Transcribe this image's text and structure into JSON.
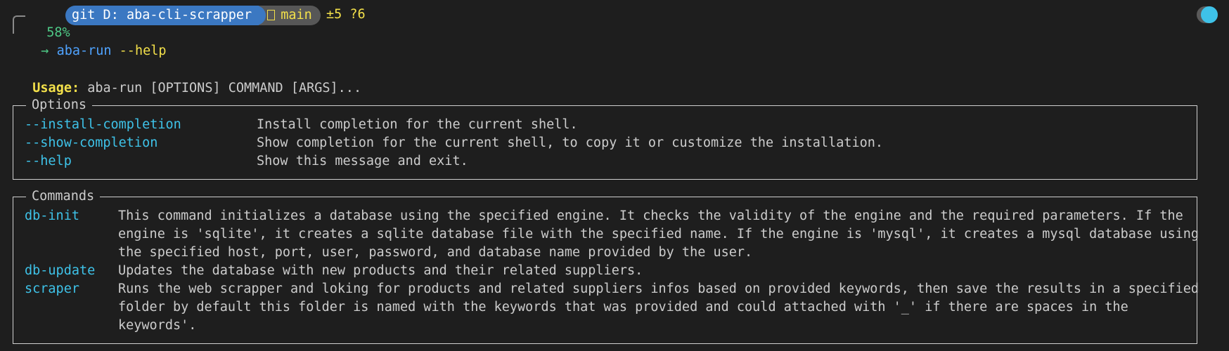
{
  "prompt": {
    "battery": "58%",
    "git_label": "git D: aba-cli-scrapper",
    "branch": "main",
    "status": "±5 ?6",
    "arrow": "→",
    "command": "aba-run",
    "argument": "--help"
  },
  "usage": {
    "label": "Usage:",
    "text": "aba-run [OPTIONS] COMMAND [ARGS]..."
  },
  "options": {
    "title": "Options",
    "items": [
      {
        "name": "--install-completion",
        "desc": "Install completion for the current shell."
      },
      {
        "name": "--show-completion",
        "desc": "Show completion for the current shell, to copy it or customize the installation."
      },
      {
        "name": "--help",
        "desc": "Show this message and exit."
      }
    ]
  },
  "commands": {
    "title": "Commands",
    "items": [
      {
        "name": "db-init",
        "desc": "This command initializes a database using the specified engine. It checks the validity of the engine and the required parameters. If the\nengine is 'sqlite', it creates a sqlite database file with the specified name. If the engine is 'mysql', it creates a mysql database using\nthe specified host, port, user, password, and database name provided by the user."
      },
      {
        "name": "db-update",
        "desc": "Updates the database with new products and their related suppliers."
      },
      {
        "name": "scraper",
        "desc": "Runs the web scrapper and loking for products and related suppliers infos based on provided keywords, then save the results in a specified\nfolder by default this folder is named with the keywords that was provided and could attached with '_' if there are spaces in the\nkeywords'."
      }
    ]
  },
  "icons": {
    "branch": "git-branch-icon",
    "toggle": "toggle-icon"
  },
  "colors": {
    "background": "#1e1e1e",
    "git_pill": "#3b78c2",
    "accent_cyan": "#3ec2e8",
    "accent_yellow": "#f3e04a",
    "accent_green": "#4ec986"
  }
}
